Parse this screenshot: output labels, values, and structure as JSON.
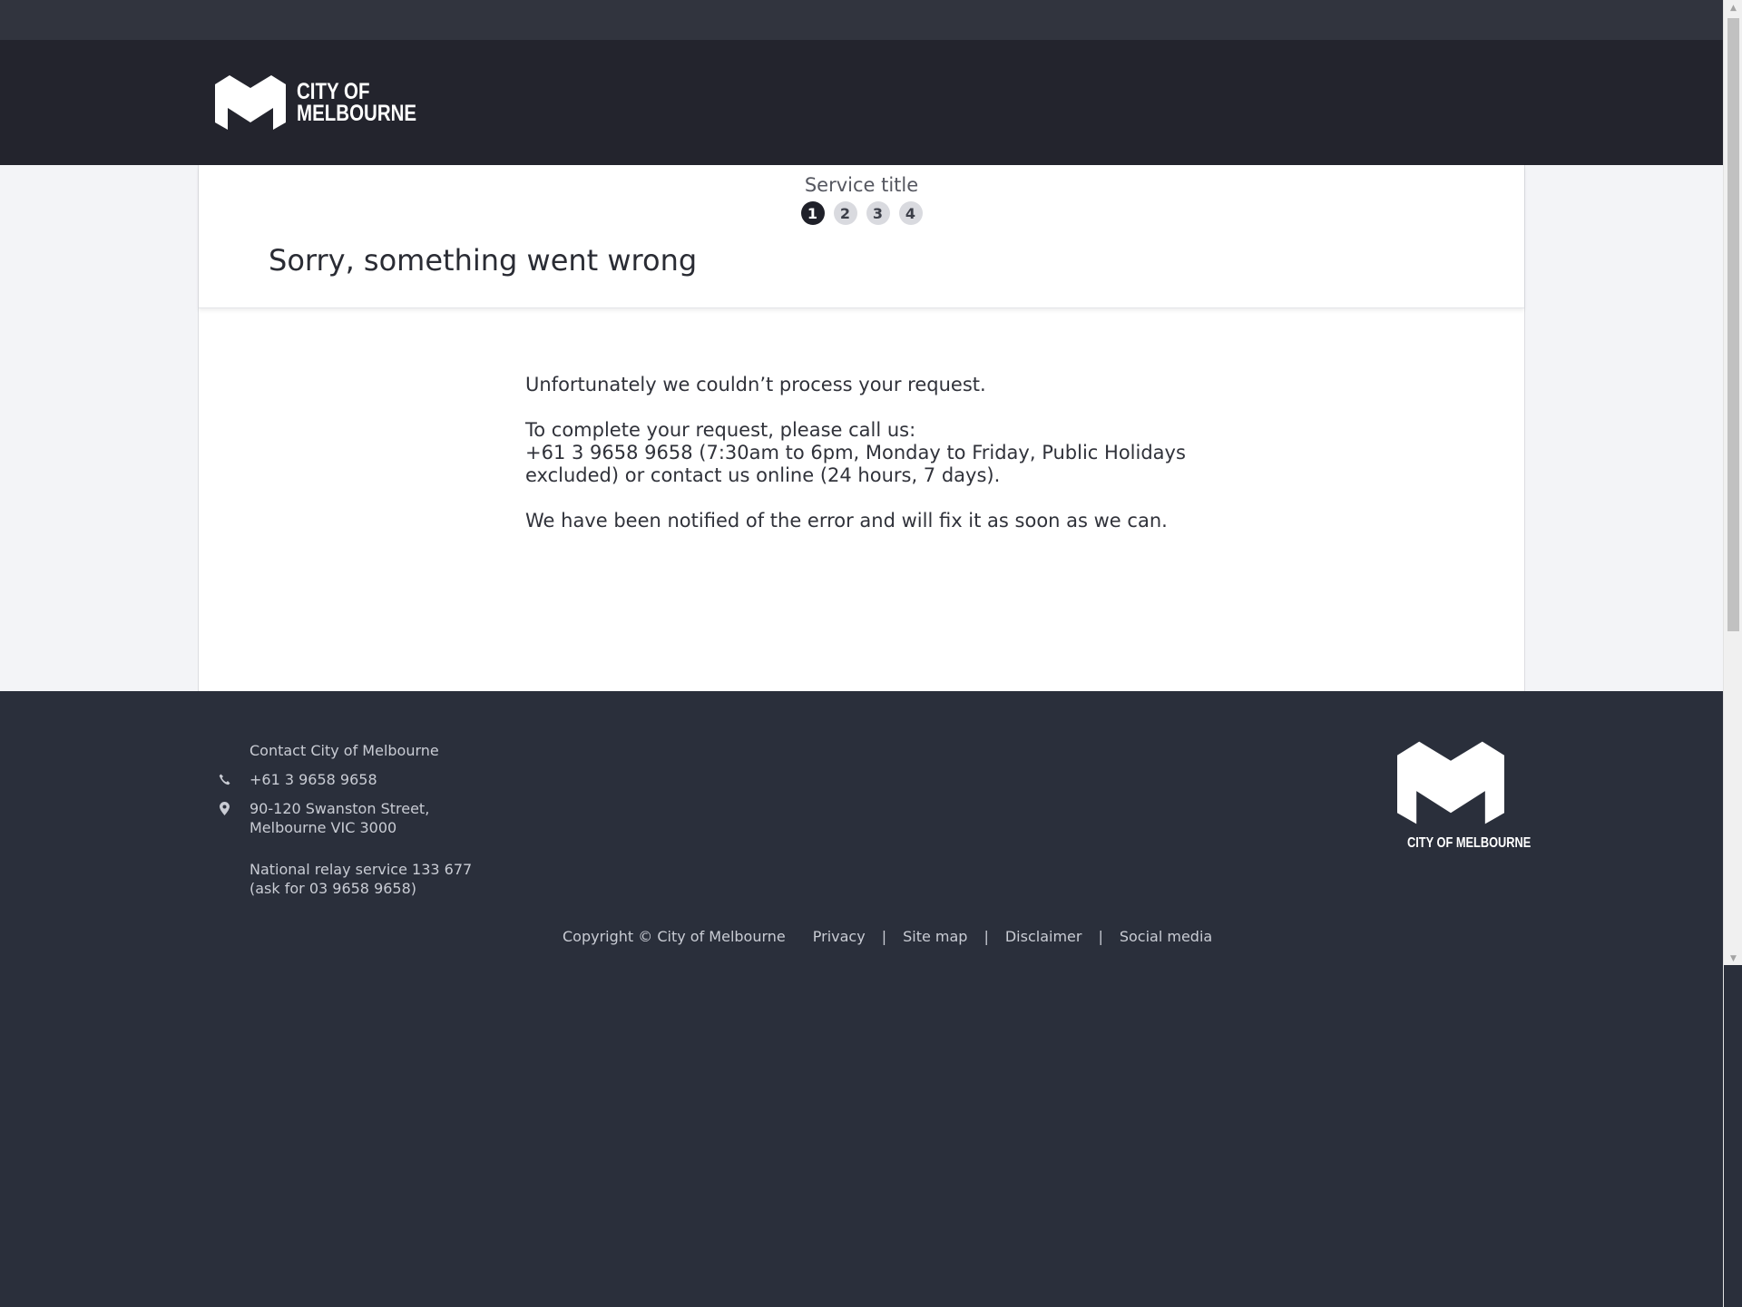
{
  "header": {
    "logo_line1": "CITY OF",
    "logo_line2": "MELBOURNE"
  },
  "service": {
    "title": "Service title",
    "steps": [
      "1",
      "2",
      "3",
      "4"
    ],
    "active_step": 1
  },
  "error": {
    "title": "Sorry, something went wrong",
    "para1": "Unfortunately we couldn’t process your request.",
    "para2_line1": "To complete your request, please call us:",
    "para2_line2": "+61 3 9658 9658 (7:30am to 6pm, Monday to Friday, Public Holidays excluded) or contact us online (24 hours, 7 days).",
    "para3": "We have been notified of the error and will fix it as soon as we can."
  },
  "footer": {
    "contact_heading": "Contact City of Melbourne",
    "phone": "+61 3 9658 9658",
    "address_line1": "90-120 Swanston Street,",
    "address_line2": "Melbourne VIC 3000",
    "relay_line1": "National relay service 133 677",
    "relay_line2": "(ask for 03 9658 9658)",
    "logo_text": "CITY OF MELBOURNE",
    "copyright": "Copyright © City of Melbourne",
    "links": {
      "privacy": "Privacy",
      "sitemap": "Site map",
      "disclaimer": "Disclaimer",
      "social": "Social media"
    },
    "separator": "|"
  },
  "icons": {
    "phone": "phone-icon",
    "location": "map-pin-icon",
    "logo": "city-of-melbourne-m-logo"
  },
  "colors": {
    "header_bg": "#23242d",
    "footer_bg": "#2a2f3b",
    "active_step": "#1f2029",
    "inactive_step": "#d9dadf"
  }
}
